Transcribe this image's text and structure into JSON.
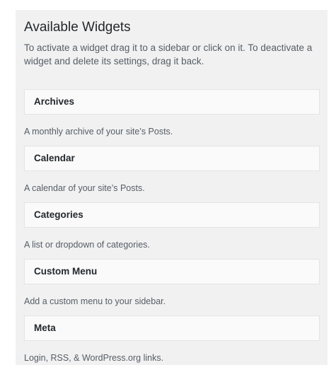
{
  "panel": {
    "title": "Available Widgets",
    "description": "To activate a widget drag it to a sidebar or click on it. To deactivate a widget and delete its settings, drag it back."
  },
  "widgets": [
    {
      "name": "Archives",
      "description": "A monthly archive of your site’s Posts."
    },
    {
      "name": "Calendar",
      "description": "A calendar of your site’s Posts."
    },
    {
      "name": "Categories",
      "description": "A list or dropdown of categories."
    },
    {
      "name": "Custom Menu",
      "description": "Add a custom menu to your sidebar."
    },
    {
      "name": "Meta",
      "description": "Login, RSS, & WordPress.org links."
    }
  ]
}
